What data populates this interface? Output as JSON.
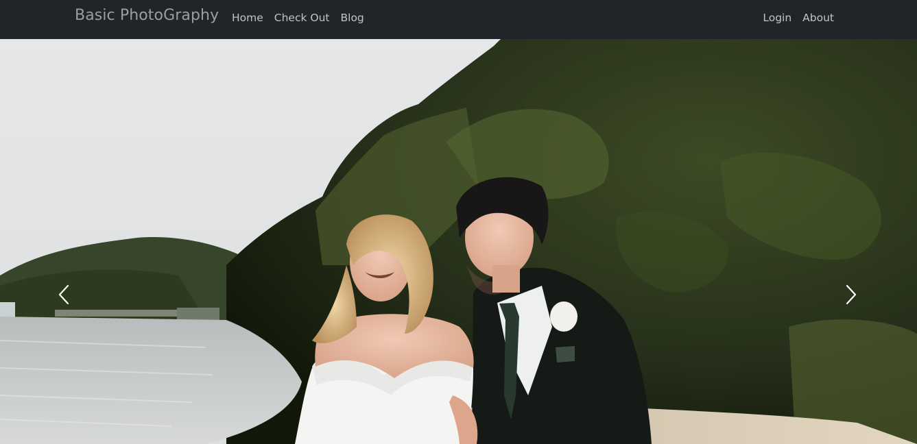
{
  "navbar": {
    "brand": "Basic PhotoGraphy",
    "left_links": [
      "Home",
      "Check Out",
      "Blog"
    ],
    "right_links": [
      "Login",
      "About"
    ]
  },
  "carousel": {
    "slide_description": "wedding-couple-on-beach",
    "prev_icon": "chevron-left-icon",
    "next_icon": "chevron-right-icon"
  }
}
